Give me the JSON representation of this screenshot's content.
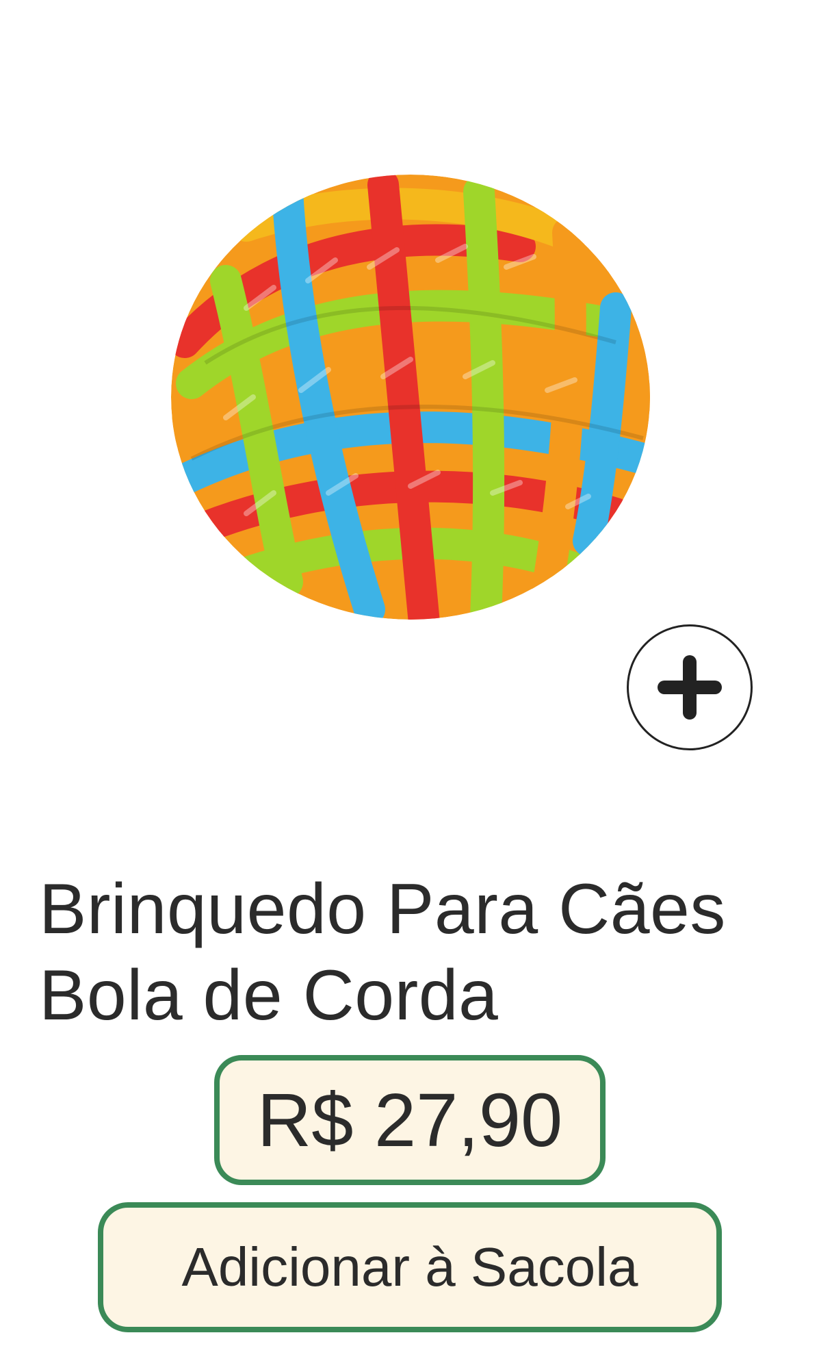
{
  "product": {
    "image_name": "rope-ball-toy",
    "title": "Brinquedo Para Cães Bola de Corda",
    "price": "R$ 27,90",
    "add_to_bag_label": "Adicionar à Sacola"
  },
  "colors": {
    "accent_border": "#3b8a57",
    "button_fill": "#fdf5e4",
    "text": "#2b2b2b"
  }
}
